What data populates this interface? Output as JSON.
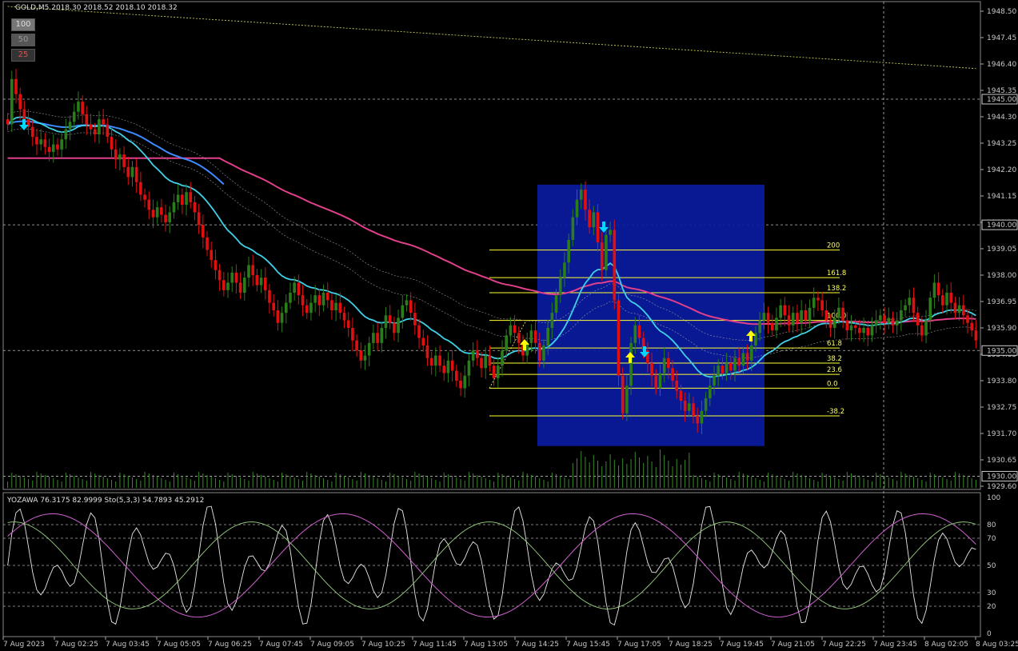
{
  "header": {
    "symbol_line": "GOLD,M5  2018.30 2018.52 2018.10 2018.32",
    "sub_line": "YOZAWA 76.3175 82.9999  Sto(5,3,3) 54.7893 45.2912"
  },
  "zoom_buttons": [
    "100",
    "50",
    "25"
  ],
  "colors": {
    "background": "#000000",
    "bull": "#2a7d1a",
    "bear": "#e01010",
    "ma_fast": "#40d0e8",
    "ma_mid": "#3c8cff",
    "ma_slow": "#e0408a",
    "fib": "#ffff33",
    "box": "#0a1aa0",
    "arrow_up": "#ffff00",
    "arrow_down": "#00d8ff"
  },
  "price_labels": [
    "1948.50",
    "1947.45",
    "1946.40",
    "1945.35",
    "1944.30",
    "1943.25",
    "1942.20",
    "1941.15",
    "1940.10",
    "1939.05",
    "1938.00",
    "1936.95",
    "1935.90",
    "1934.85",
    "1933.80",
    "1932.75",
    "1931.70",
    "1930.65",
    "1929.60"
  ],
  "highlight_prices": [
    "1945.00",
    "1940.00",
    "1935.00",
    "1930.00"
  ],
  "osc_labels": [
    "100",
    "80",
    "70",
    "50",
    "30",
    "20",
    "0"
  ],
  "time_labels": [
    "7 Aug 2023",
    "7 Aug 02:25",
    "7 Aug 03:45",
    "7 Aug 05:05",
    "7 Aug 06:25",
    "7 Aug 07:45",
    "7 Aug 09:05",
    "7 Aug 10:25",
    "7 Aug 11:45",
    "7 Aug 13:05",
    "7 Aug 14:25",
    "7 Aug 15:45",
    "7 Aug 17:05",
    "7 Aug 18:25",
    "7 Aug 19:45",
    "7 Aug 21:05",
    "7 Aug 22:25",
    "7 Aug 23:45",
    "8 Aug 02:05",
    "8 Aug 03:25"
  ],
  "fib_levels": [
    {
      "label": "200",
      "price": 1939.0
    },
    {
      "label": "161.8",
      "price": 1937.9
    },
    {
      "label": "138.2",
      "price": 1937.3
    },
    {
      "label": "100.0",
      "price": 1936.2
    },
    {
      "label": "61.8",
      "price": 1935.1
    },
    {
      "label": "38.2",
      "price": 1934.5
    },
    {
      "label": "23.6",
      "price": 1934.05
    },
    {
      "label": "0.0",
      "price": 1933.5
    },
    {
      "label": "-38.2",
      "price": 1932.4
    }
  ],
  "chart_data": {
    "type": "candlestick",
    "symbol": "GOLD",
    "timeframe": "M5",
    "price_range": [
      1929.6,
      1949.0
    ],
    "oscillator_range": [
      0,
      100
    ],
    "closes": [
      1944.0,
      1945.8,
      1945.2,
      1944.6,
      1944.2,
      1943.9,
      1943.5,
      1943.2,
      1943.4,
      1943.1,
      1942.9,
      1943.2,
      1943.0,
      1943.4,
      1943.8,
      1944.1,
      1944.5,
      1944.9,
      1944.4,
      1944.0,
      1943.8,
      1943.6,
      1944.2,
      1944.0,
      1943.5,
      1943.0,
      1942.6,
      1942.8,
      1942.3,
      1941.9,
      1942.3,
      1941.7,
      1941.2,
      1941.0,
      1940.6,
      1940.3,
      1940.7,
      1940.4,
      1940.1,
      1940.5,
      1940.9,
      1941.2,
      1940.8,
      1941.3,
      1940.9,
      1940.5,
      1940.0,
      1939.5,
      1939.0,
      1938.6,
      1938.2,
      1937.8,
      1937.4,
      1937.7,
      1938.1,
      1937.7,
      1937.3,
      1937.9,
      1938.4,
      1938.0,
      1937.6,
      1937.9,
      1937.4,
      1936.9,
      1936.6,
      1936.1,
      1936.5,
      1936.9,
      1937.3,
      1937.7,
      1937.2,
      1936.8,
      1936.5,
      1936.9,
      1937.2,
      1936.8,
      1937.3,
      1937.0,
      1936.6,
      1936.9,
      1936.5,
      1936.2,
      1935.9,
      1935.4,
      1935.0,
      1934.6,
      1934.8,
      1935.3,
      1935.7,
      1935.3,
      1935.9,
      1936.4,
      1936.1,
      1935.7,
      1936.3,
      1936.8,
      1937.0,
      1936.5,
      1936.0,
      1935.5,
      1935.2,
      1934.7,
      1934.4,
      1934.8,
      1934.4,
      1934.1,
      1934.6,
      1934.2,
      1933.8,
      1933.5,
      1934.0,
      1934.6,
      1935.0,
      1934.7,
      1934.3,
      1934.8,
      1934.4,
      1933.9,
      1934.4,
      1935.0,
      1935.6,
      1936.0,
      1935.7,
      1935.3,
      1934.8,
      1935.3,
      1935.8,
      1935.3,
      1934.6,
      1935.2,
      1935.9,
      1936.5,
      1937.2,
      1937.9,
      1938.5,
      1939.4,
      1940.3,
      1941.0,
      1941.4,
      1940.6,
      1939.9,
      1940.5,
      1939.3,
      1938.2,
      1939.6,
      1939.8,
      1937.0,
      1934.0,
      1932.5,
      1933.6,
      1935.3,
      1936.0,
      1935.5,
      1935.0,
      1934.5,
      1934.0,
      1933.5,
      1934.1,
      1934.7,
      1934.3,
      1933.8,
      1933.4,
      1933.0,
      1932.6,
      1932.9,
      1932.4,
      1932.1,
      1932.6,
      1933.1,
      1933.6,
      1934.0,
      1934.4,
      1934.1,
      1934.5,
      1934.2,
      1934.7,
      1934.4,
      1934.9,
      1934.6,
      1935.2,
      1935.7,
      1936.2,
      1936.5,
      1936.1,
      1935.8,
      1936.3,
      1936.8,
      1936.4,
      1936.0,
      1936.5,
      1936.1,
      1936.6,
      1936.2,
      1936.7,
      1937.1,
      1937.0,
      1936.6,
      1936.2,
      1935.9,
      1936.3,
      1936.7,
      1936.2,
      1935.8,
      1936.0,
      1935.9,
      1935.7,
      1935.9,
      1935.6,
      1936.0,
      1936.2,
      1936.4,
      1936.1,
      1936.3,
      1936.0,
      1936.2,
      1936.6,
      1936.8,
      1937.1,
      1936.5,
      1936.0,
      1935.6,
      1936.2,
      1937.1,
      1937.7,
      1937.2,
      1936.8,
      1937.3,
      1936.9,
      1936.5,
      1936.8,
      1936.4,
      1936.1,
      1935.8,
      1935.4
    ],
    "ema_fast_note": "computed from closes",
    "volume_note": "tick volume bars along bottom of main pane",
    "oscillator_series": [
      "YOZAWA",
      "Sto(5,3,3)"
    ]
  }
}
